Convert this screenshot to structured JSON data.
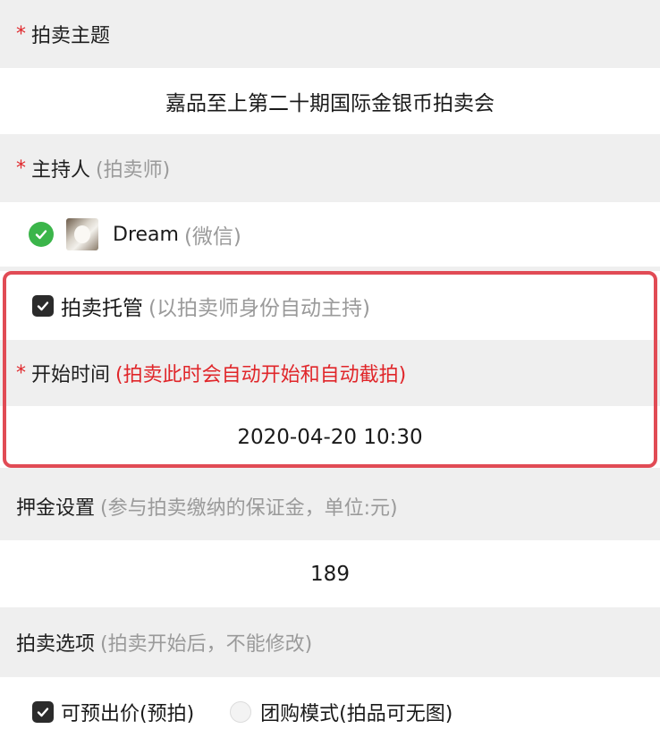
{
  "theme": {
    "label": "拍卖主题",
    "value": "嘉品至上第二十期国际金银币拍卖会"
  },
  "host": {
    "label": "主持人",
    "hint": "(拍卖师)",
    "name": "Dream",
    "name_hint": "(微信)"
  },
  "auto_host": {
    "label": "拍卖托管",
    "hint": "(以拍卖师身份自动主持)",
    "checked": true
  },
  "start_time": {
    "label": "开始时间",
    "hint": "(拍卖此时会自动开始和自动截拍)",
    "value": "2020-04-20 10:30"
  },
  "deposit": {
    "label": "押金设置",
    "hint": "(参与拍卖缴纳的保证金，单位:元)",
    "value": "189"
  },
  "options": {
    "label": "拍卖选项",
    "hint": "(拍卖开始后，不能修改)",
    "items": [
      {
        "label": "可预出价(预拍)",
        "checked": true
      },
      {
        "label": "团购模式(拍品可无图)",
        "checked": false
      }
    ]
  },
  "required_mark": "*",
  "colors": {
    "accent_red": "#e0262a",
    "highlight_border": "#e14b55",
    "check_green": "#3bb54a",
    "hint_gray": "#9a9a9a"
  }
}
